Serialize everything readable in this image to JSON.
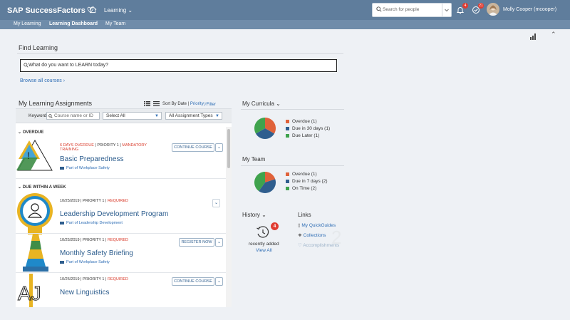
{
  "header": {
    "brand": "SAP SuccessFactors",
    "menu_label": "Learning",
    "search_placeholder": "Search for people",
    "notifications_count": "4",
    "approvals_count": "21",
    "user_name": "Molly Cooper (mcooper)"
  },
  "subnav": {
    "tabs": [
      "My Learning",
      "Learning Dashboard",
      "My Team"
    ],
    "active": "Learning Dashboard"
  },
  "find_learning": {
    "title": "Find Learning",
    "placeholder": "What do you want to LEARN today?",
    "browse_label": "Browse all courses"
  },
  "assignments": {
    "title": "My Learning Assignments",
    "sort_prefix": "Sort By Date |",
    "sort_priority": "Priority",
    "filter_label": "Filter",
    "keyword_label": "Keyword",
    "keyword_placeholder": "Course name or ID",
    "select_all": "Select All",
    "type_select": "All Assignment Types",
    "sections": {
      "overdue": "OVERDUE",
      "due_week": "DUE WITHIN A WEEK"
    },
    "items": [
      {
        "meta": "6 DAYS OVERDUE",
        "priority": "PRIORITY 1",
        "req": "MANDATORY",
        "req2": "TRAINING",
        "title": "Basic Preparedness",
        "sub": "Part of Workplace Safety",
        "button": "CONTINUE COURSE"
      },
      {
        "meta": "10/25/2019",
        "priority": "PRIORITY 1",
        "req": "REQUIRED",
        "title": "Leadership Development Program",
        "sub": "Part of Leadership Development",
        "button": ""
      },
      {
        "meta": "10/25/2019",
        "priority": "PRIORITY 1",
        "req": "REQUIRED",
        "title": "Monthly Safety Briefing",
        "sub": "Part of Workplace Safety",
        "button": "REGISTER NOW"
      },
      {
        "meta": "10/25/2019",
        "priority": "PRIORITY 1",
        "req": "REQUIRED",
        "title": "New Linguistics",
        "sub": "",
        "button": "CONTINUE COURSE"
      }
    ]
  },
  "curricula": {
    "title": "My Curricula",
    "legend": [
      "Overdue (1)",
      "Due in 30 days (1)",
      "Due Later (1)"
    ],
    "values": [
      1,
      1,
      1
    ],
    "colors": [
      "#e0623a",
      "#2f5e8e",
      "#3fa34d"
    ]
  },
  "team": {
    "title": "My Team",
    "legend": [
      "Overdue (1)",
      "Due in 7 days (2)",
      "On Time (2)"
    ],
    "values": [
      1,
      2,
      2
    ],
    "colors": [
      "#e0623a",
      "#2f5e8e",
      "#3fa34d"
    ]
  },
  "history": {
    "title": "History",
    "count": "4",
    "label": "recently added",
    "view_all": "View All"
  },
  "links": {
    "title": "Links",
    "items": [
      "My QuickGuides",
      "Collections",
      "Accomplishments"
    ]
  }
}
